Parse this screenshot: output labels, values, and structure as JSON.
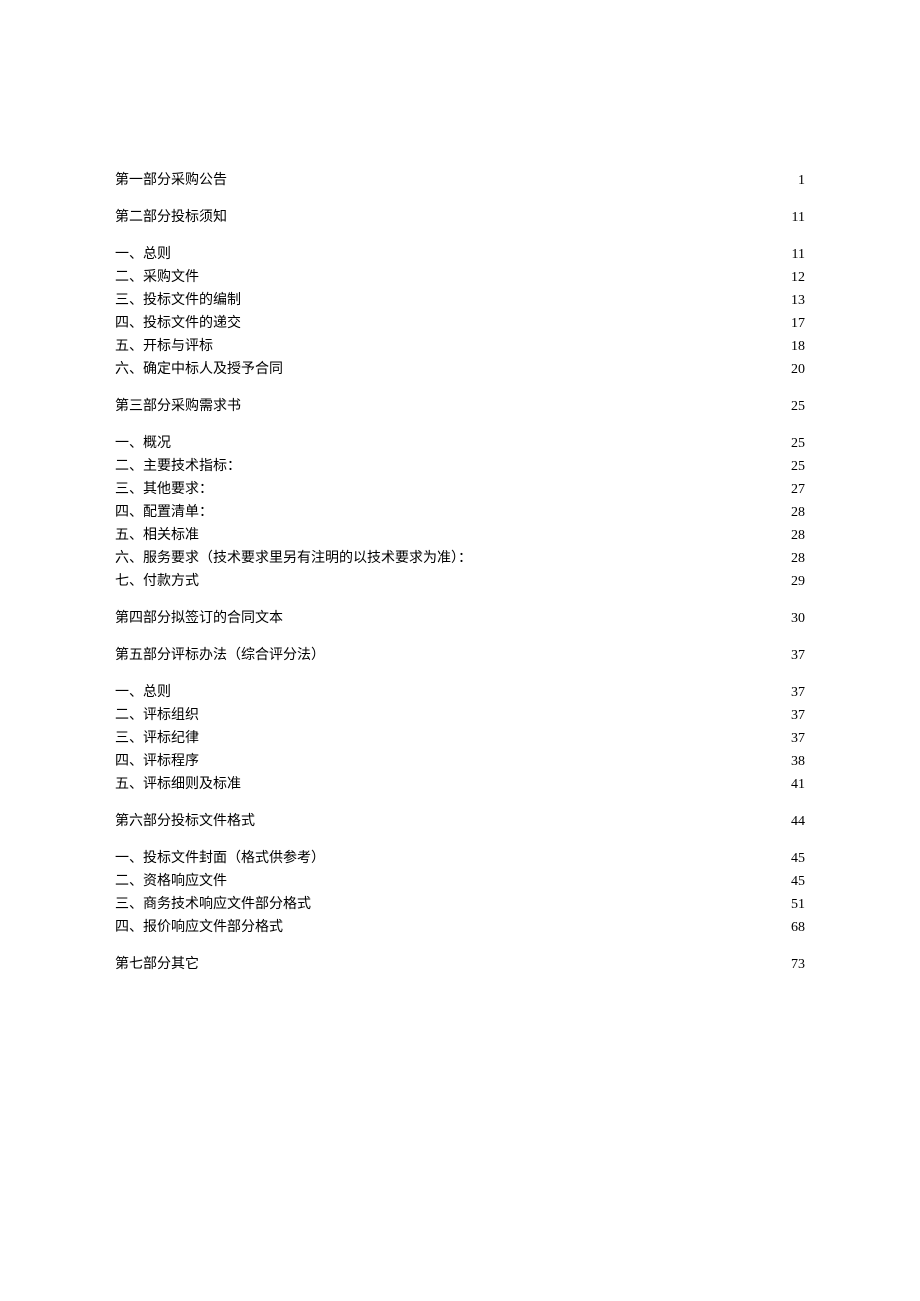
{
  "toc": [
    {
      "type": "main",
      "label": "第一部分采购公告",
      "page": "1"
    },
    {
      "type": "gap"
    },
    {
      "type": "main",
      "label": "第二部分投标须知",
      "page": "11"
    },
    {
      "type": "gap"
    },
    {
      "type": "sub",
      "label": "一、总则",
      "page": "11"
    },
    {
      "type": "sub",
      "label": "二、采购文件",
      "page": "12"
    },
    {
      "type": "sub",
      "label": "三、投标文件的编制",
      "page": "13"
    },
    {
      "type": "sub",
      "label": "四、投标文件的递交",
      "page": "17"
    },
    {
      "type": "sub",
      "label": "五、开标与评标",
      "page": "18"
    },
    {
      "type": "sub",
      "label": "六、确定中标人及授予合同",
      "page": "20"
    },
    {
      "type": "gap"
    },
    {
      "type": "main",
      "label": "第三部分采购需求书",
      "page": "25"
    },
    {
      "type": "gap"
    },
    {
      "type": "sub",
      "label": "一、概况",
      "page": "25"
    },
    {
      "type": "sub",
      "label": "二、主要技术指标：",
      "page": "25"
    },
    {
      "type": "sub",
      "label": "三、其他要求：",
      "page": "27"
    },
    {
      "type": "sub",
      "label": "四、配置清单：",
      "page": "28"
    },
    {
      "type": "sub",
      "label": "五、相关标准",
      "page": "28"
    },
    {
      "type": "sub",
      "label": "六、服务要求（技术要求里另有注明的以技术要求为准）：",
      "page": "28"
    },
    {
      "type": "sub",
      "label": "七、付款方式",
      "page": "29"
    },
    {
      "type": "gap"
    },
    {
      "type": "main",
      "label": "第四部分拟签订的合同文本",
      "page": "30"
    },
    {
      "type": "gap"
    },
    {
      "type": "main",
      "label": "第五部分评标办法（综合评分法）",
      "page": "37"
    },
    {
      "type": "gap"
    },
    {
      "type": "sub",
      "label": "一、总则",
      "page": "37"
    },
    {
      "type": "sub",
      "label": "二、评标组织",
      "page": "37"
    },
    {
      "type": "sub",
      "label": "三、评标纪律",
      "page": "37"
    },
    {
      "type": "sub",
      "label": "四、评标程序",
      "page": "38"
    },
    {
      "type": "sub",
      "label": "五、评标细则及标准",
      "page": "41"
    },
    {
      "type": "gap"
    },
    {
      "type": "main",
      "label": "第六部分投标文件格式",
      "page": "44"
    },
    {
      "type": "gap"
    },
    {
      "type": "sub",
      "label": "一、投标文件封面（格式供参考）",
      "page": "45"
    },
    {
      "type": "sub",
      "label": "二、资格响应文件",
      "page": "45"
    },
    {
      "type": "sub",
      "label": "三、商务技术响应文件部分格式",
      "page": "51"
    },
    {
      "type": "sub",
      "label": "四、报价响应文件部分格式",
      "page": "68"
    },
    {
      "type": "gap"
    },
    {
      "type": "main",
      "label": "第七部分其它",
      "page": "73"
    }
  ]
}
